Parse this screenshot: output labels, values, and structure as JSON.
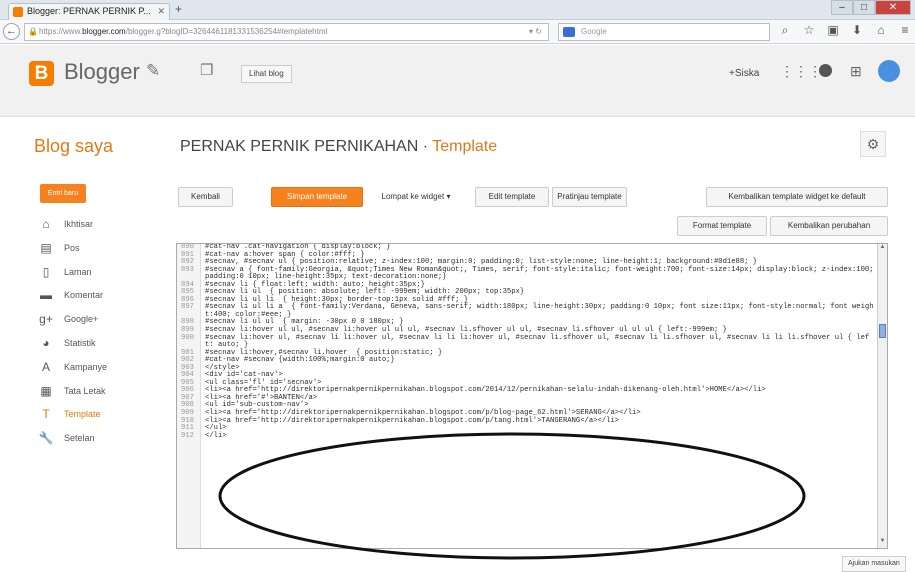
{
  "browser": {
    "tab_title": "Blogger: PERNAK PERNIK P...",
    "url_prefix": "https://www.",
    "url_domain": "blogger.com",
    "url_rest": "/blogger.g?blogID=3264461181331536254#templatehtml",
    "search_placeholder": "Google"
  },
  "header": {
    "logo_letter": "B",
    "brand": "Blogger",
    "view_blog": "Lihat blog",
    "user": "+Siska"
  },
  "page": {
    "blog_saya": "Blog saya",
    "blog_title": "PERNAK PERNIK PERNIKAHAN",
    "separator": " · ",
    "section": "Template"
  },
  "sidebar": {
    "new_post": "Entri baru",
    "items": [
      {
        "label": "Ikhtisar",
        "icon": "home-icon"
      },
      {
        "label": "Pos",
        "icon": "document-icon"
      },
      {
        "label": "Laman",
        "icon": "page-icon"
      },
      {
        "label": "Komentar",
        "icon": "comment-icon"
      },
      {
        "label": "Google+",
        "icon": "google-plus-icon"
      },
      {
        "label": "Statistik",
        "icon": "chart-icon"
      },
      {
        "label": "Kampanye",
        "icon": "campaign-icon"
      },
      {
        "label": "Tata Letak",
        "icon": "layout-icon"
      },
      {
        "label": "Template",
        "icon": "template-icon"
      },
      {
        "label": "Setelan",
        "icon": "wrench-icon"
      }
    ]
  },
  "toolbar": {
    "kembali": "Kembali",
    "simpan": "Simpan template",
    "lompat": "Lompat ke widget",
    "edit": "Edit template",
    "pratinjau": "Pratinjau template",
    "kembalikan_default": "Kembalikan template widget ke default",
    "format": "Format template",
    "kembalikan_perubahan": "Kembalikan perubahan"
  },
  "code_lines": [
    {
      "n": "890",
      "t": "#cat-nav .cat-navigation { display:block; }"
    },
    {
      "n": "891",
      "t": "#cat-nav a:hover span { color:#fff; }"
    },
    {
      "n": "892",
      "t": "#secnav, #secnav ul { position:relative; z-index:100; margin:0; padding:0; list-style:none; line-height:1; background:#0d1e88; }"
    },
    {
      "n": "893",
      "t": "#secnav a { font-family:Georgia, &quot;Times New Roman&quot;, Times, serif; font-style:italic; font-weight:700; font-size:14px; display:block; z-index:100; padding:0 10px; line-height:35px; text-decoration:none;}"
    },
    {
      "n": "894",
      "t": "#secnav li { float:left; width: auto; height:35px;}"
    },
    {
      "n": "895",
      "t": "#secnav li ul  { position: absolute; left: -999em; width: 200px; top:35px}"
    },
    {
      "n": "896",
      "t": "#secnav li ul li  { height:30px; border-top:1px solid #fff; }"
    },
    {
      "n": "897",
      "t": "#secnav li ul li a  { font-family:Verdana, Geneva, sans-serif; width:180px; line-height:30px; padding:0 10px; font size:11px; font-style:normal; font weight:400; color:#eee; }"
    },
    {
      "n": "898",
      "t": "#secnav li ul ul  { margin: -30px 0 0 180px; }"
    },
    {
      "n": "899",
      "t": "#secnav li:hover ul ul, #secnav li:hover ul ul ul, #secnav li.sfhover ul ul, #secnav li.sfhover ul ul ul { left:-999em; }"
    },
    {
      "n": "900",
      "t": "#secnav li:hover ul, #secnav li li:hover ul, #secnav li li li:hover ul, #secnav li.sfhover ul, #secnav li li.sfhover ul, #secnav li li li.sfhover ul { left: auto; }"
    },
    {
      "n": "901",
      "t": "#secnav li:hover,#secnav li.hover  { position:static; }"
    },
    {
      "n": "902",
      "t": "#cat-nav #secnav {width:100%;margin:0 auto;}"
    },
    {
      "n": "903",
      "t": "</style>"
    },
    {
      "n": "904",
      "t": "<div id='cat-nav'>"
    },
    {
      "n": "905",
      "t": "<ul class='fl' id='secnav'>"
    },
    {
      "n": "906",
      "t": "<li><a href='http://direktoripernakpernikpernikahan.blogspot.com/2014/12/pernikahan-selalu-indah-dikenang-oleh.html'>HOME</a></li>"
    },
    {
      "n": "907",
      "t": "<li><a href='#'>BANTEN</a>"
    },
    {
      "n": "908",
      "t": "<ul id='sub-custom-nav'>"
    },
    {
      "n": "909",
      "t": "<li><a href='http://direktoripernakpernikpernikahan.blogspot.com/p/blog-page_62.html'>SERANG</a></li>"
    },
    {
      "n": "910",
      "t": "<li><a href='http://direktoripernakpernikpernikahan.blogspot.com/p/tang.html'>TANGERANG</a></li>"
    },
    {
      "n": "911",
      "t": "</ul>"
    },
    {
      "n": "912",
      "t": "</li>"
    }
  ],
  "feedback": "Ajukan masukan"
}
